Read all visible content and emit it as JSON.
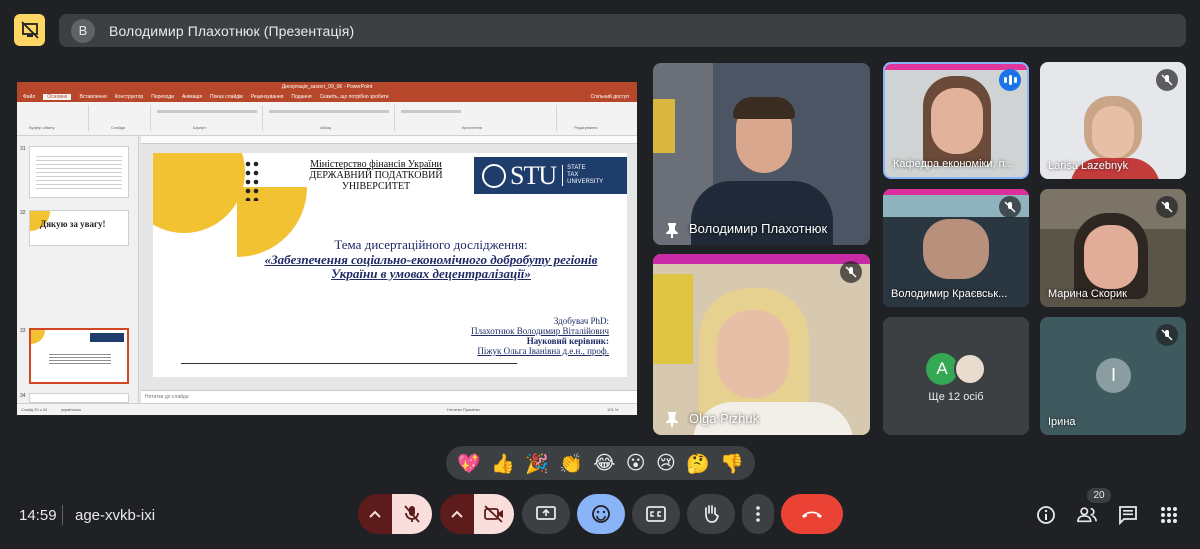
{
  "header": {
    "presenter_initial": "В",
    "presentation_title": "Володимир Плахотнюк (Презентація)"
  },
  "ppt": {
    "window_title": "Дисертація_захист_09_06  -  PowerPoint",
    "tabs": [
      "Файл",
      "Основне",
      "Вставлення",
      "Конструктор",
      "Переходи",
      "Анімація",
      "Показ слайдів",
      "Рецензування",
      "Подання",
      "Скажіть, що потрібно зробити",
      "Спільний доступ"
    ],
    "ribbon_groups": [
      "Буфер обміну",
      "Слайди",
      "Шрифт",
      "Абзац",
      "Креслення",
      "Редагування"
    ],
    "slide_numbers": [
      "31",
      "32",
      "33",
      "34"
    ],
    "thumb32_text": "Дякую за увагу!",
    "notes_placeholder": "Нотатки до слайда",
    "status_left": "Слайд 33 з 34",
    "status_lang": "українська",
    "status_right": "Нотатки    Примітки",
    "zoom": "101 %"
  },
  "slide": {
    "ministry_lines": [
      "Міністерство фінансів України",
      "ДЕРЖАВНИЙ ПОДАТКОВИЙ",
      "УНІВЕРСИТЕТ"
    ],
    "logo_text": "STU",
    "logo_sub": [
      "STATE",
      "TAX",
      "UNIVERSITY"
    ],
    "topic_heading": "Тема дисертаційного дослідження:",
    "topic_title": "«Забезпечення соціально-економічного добробуту регіонів України в умовах децентралізації»",
    "applicant_label": "Здобувач PhD:",
    "applicant_name": "Плахотнюк Володимир Віталійович",
    "supervisor_label": "Науковий керівник:",
    "supervisor_name": "Піжук Ольга Іванівна д.е.н., проф."
  },
  "participants": {
    "main_speaker": "Володимир Плахотнюк",
    "olga": "Olga Pizhuk",
    "kafedra": "Кафедра економіки, п...",
    "larisa": "Larisa Lazebnyk",
    "volodymyr_k": "Володимир Краєвськ...",
    "maryna": "Марина Скорик",
    "more_initial": "А",
    "more_label": "Ще 12 осіб",
    "iryna_initial": "І",
    "iryna": "Ірина"
  },
  "reactions": [
    "💖",
    "👍",
    "🎉",
    "👏",
    "😂",
    "😮",
    "😢",
    "🤔",
    "👎"
  ],
  "bottom": {
    "time": "14:59",
    "meeting_code": "age-xvkb-ixi",
    "participant_count": "20"
  },
  "colors": {
    "accent_yellow": "#fdd663",
    "end_call": "#ea4335",
    "mic_off_bg": "#f9dedc",
    "ppt_red": "#b7472a",
    "blue_active": "#8ab4f8"
  }
}
